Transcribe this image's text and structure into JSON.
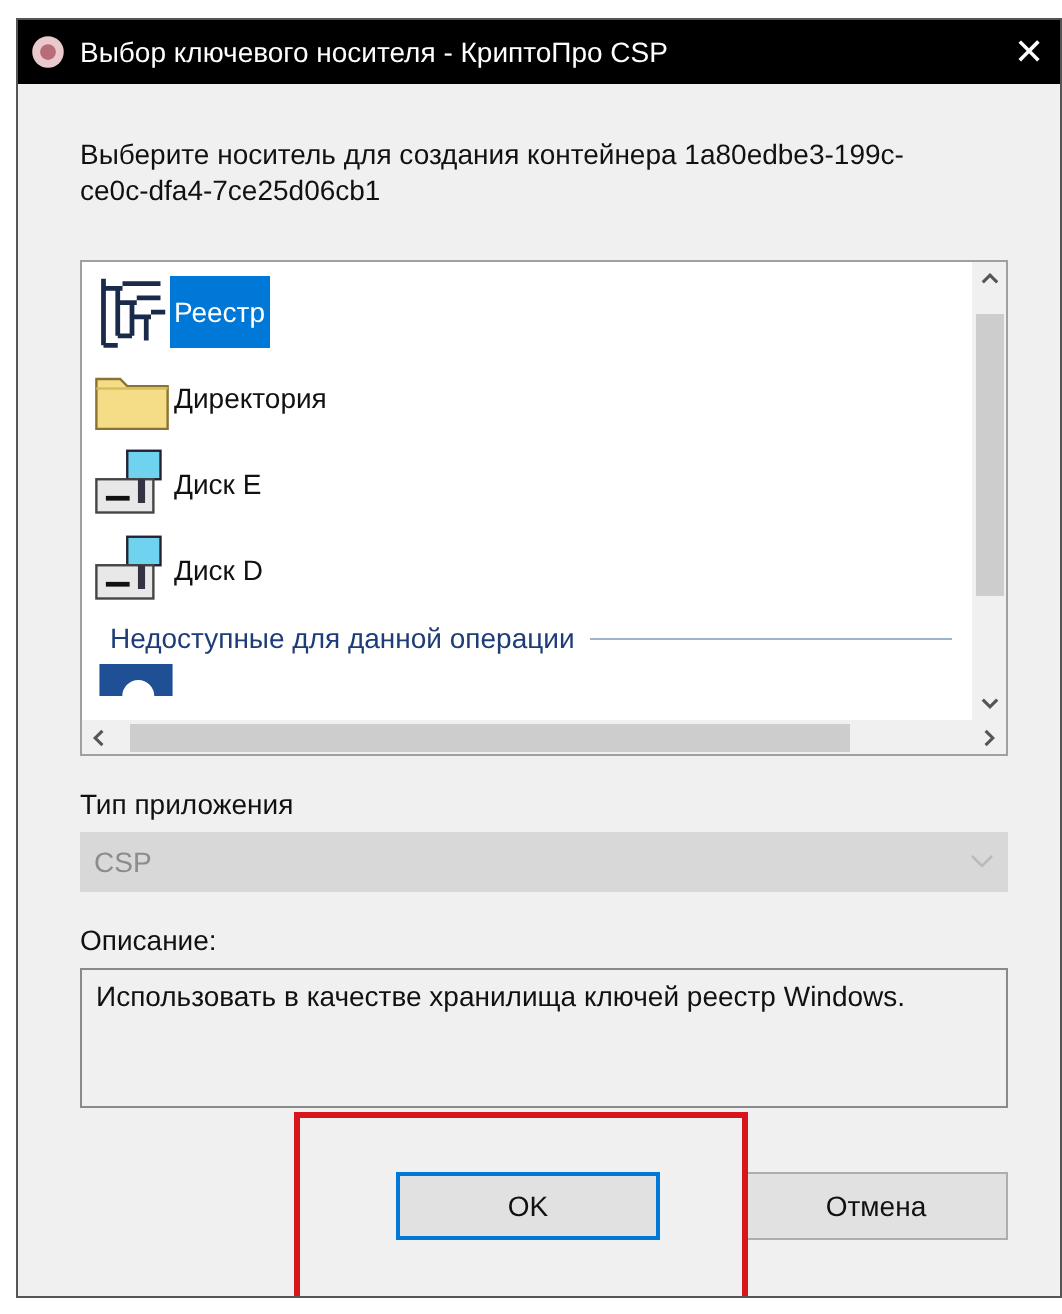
{
  "window": {
    "title": "Выбор ключевого носителя - КриптоПро CSP",
    "close": "✕"
  },
  "prompt": "Выберите носитель для создания контейнера 1a80edbe3-199c-ce0c-dfa4-7ce25d06cb1",
  "media": [
    {
      "kind": "registry",
      "label": "Реестр",
      "selected": true
    },
    {
      "kind": "folder",
      "label": "Директория",
      "selected": false
    },
    {
      "kind": "drive",
      "label": "Диск E",
      "selected": false
    },
    {
      "kind": "drive",
      "label": "Диск D",
      "selected": false
    }
  ],
  "unavailable": {
    "header": "Недоступные для данной операции",
    "items": [
      {
        "kind": "token"
      }
    ]
  },
  "app_type": {
    "label": "Тип приложения",
    "value": "CSP",
    "disabled": true
  },
  "description": {
    "label": "Описание:",
    "text": "Использовать в качестве хранилища ключей реестр Windows."
  },
  "buttons": [
    {
      "label": "OK",
      "default": true
    },
    {
      "label": "Отмена",
      "default": false
    }
  ],
  "annotation": {
    "kind": "highlight",
    "color": "#d8141c"
  }
}
